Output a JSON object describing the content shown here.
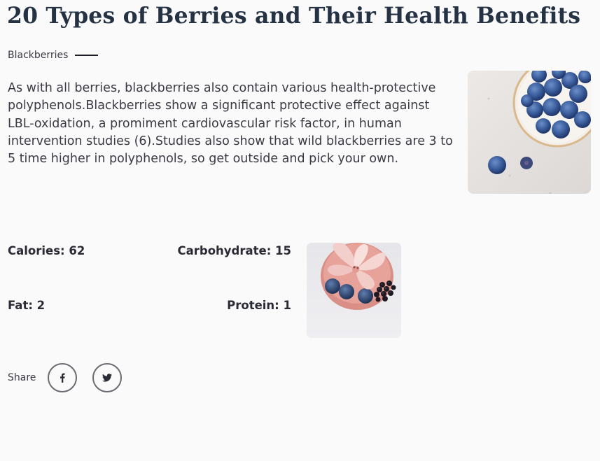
{
  "article": {
    "title": "20 Types of Berries and Their Health Benefits"
  },
  "section": {
    "name": "Blackberries",
    "description": "As with all berries, blackberries also contain  various health-protective polyphenols.Blackberries show a significant protective effect against LBL-oxidation, a promiment cardiovascular risk factor, in human intervention studies (6).Studies also show that wild blackberries are 3 to 5 time higher in polyphenols, so get outside and pick your own."
  },
  "nutrition": {
    "calories": "Calories: 62",
    "carbohydrate": "Carbohydrate: 15",
    "fat": "Fat: 2",
    "protein": "Protein: 1"
  },
  "share": {
    "label": "Share",
    "buttons": [
      {
        "icon": "facebook-icon"
      },
      {
        "icon": "twitter-icon"
      }
    ]
  },
  "colors": {
    "background": "#fafafa",
    "title": "#253244",
    "text": "#3a3a44"
  }
}
